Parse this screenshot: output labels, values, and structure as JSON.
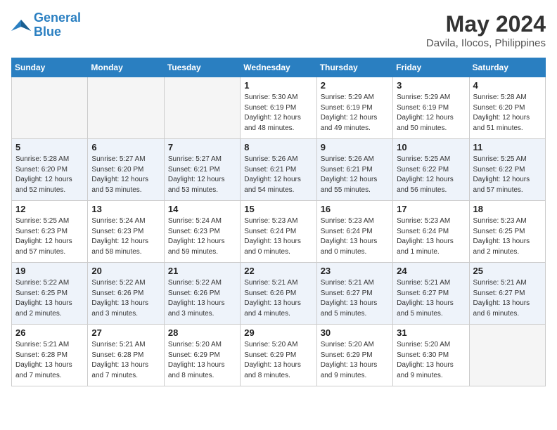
{
  "header": {
    "logo_line1": "General",
    "logo_line2": "Blue",
    "month_year": "May 2024",
    "location": "Davila, Ilocos, Philippines"
  },
  "days_of_week": [
    "Sunday",
    "Monday",
    "Tuesday",
    "Wednesday",
    "Thursday",
    "Friday",
    "Saturday"
  ],
  "weeks": [
    [
      {
        "day": "",
        "info": ""
      },
      {
        "day": "",
        "info": ""
      },
      {
        "day": "",
        "info": ""
      },
      {
        "day": "1",
        "info": "Sunrise: 5:30 AM\nSunset: 6:19 PM\nDaylight: 12 hours\nand 48 minutes."
      },
      {
        "day": "2",
        "info": "Sunrise: 5:29 AM\nSunset: 6:19 PM\nDaylight: 12 hours\nand 49 minutes."
      },
      {
        "day": "3",
        "info": "Sunrise: 5:29 AM\nSunset: 6:19 PM\nDaylight: 12 hours\nand 50 minutes."
      },
      {
        "day": "4",
        "info": "Sunrise: 5:28 AM\nSunset: 6:20 PM\nDaylight: 12 hours\nand 51 minutes."
      }
    ],
    [
      {
        "day": "5",
        "info": "Sunrise: 5:28 AM\nSunset: 6:20 PM\nDaylight: 12 hours\nand 52 minutes."
      },
      {
        "day": "6",
        "info": "Sunrise: 5:27 AM\nSunset: 6:20 PM\nDaylight: 12 hours\nand 53 minutes."
      },
      {
        "day": "7",
        "info": "Sunrise: 5:27 AM\nSunset: 6:21 PM\nDaylight: 12 hours\nand 53 minutes."
      },
      {
        "day": "8",
        "info": "Sunrise: 5:26 AM\nSunset: 6:21 PM\nDaylight: 12 hours\nand 54 minutes."
      },
      {
        "day": "9",
        "info": "Sunrise: 5:26 AM\nSunset: 6:21 PM\nDaylight: 12 hours\nand 55 minutes."
      },
      {
        "day": "10",
        "info": "Sunrise: 5:25 AM\nSunset: 6:22 PM\nDaylight: 12 hours\nand 56 minutes."
      },
      {
        "day": "11",
        "info": "Sunrise: 5:25 AM\nSunset: 6:22 PM\nDaylight: 12 hours\nand 57 minutes."
      }
    ],
    [
      {
        "day": "12",
        "info": "Sunrise: 5:25 AM\nSunset: 6:23 PM\nDaylight: 12 hours\nand 57 minutes."
      },
      {
        "day": "13",
        "info": "Sunrise: 5:24 AM\nSunset: 6:23 PM\nDaylight: 12 hours\nand 58 minutes."
      },
      {
        "day": "14",
        "info": "Sunrise: 5:24 AM\nSunset: 6:23 PM\nDaylight: 12 hours\nand 59 minutes."
      },
      {
        "day": "15",
        "info": "Sunrise: 5:23 AM\nSunset: 6:24 PM\nDaylight: 13 hours\nand 0 minutes."
      },
      {
        "day": "16",
        "info": "Sunrise: 5:23 AM\nSunset: 6:24 PM\nDaylight: 13 hours\nand 0 minutes."
      },
      {
        "day": "17",
        "info": "Sunrise: 5:23 AM\nSunset: 6:24 PM\nDaylight: 13 hours\nand 1 minute."
      },
      {
        "day": "18",
        "info": "Sunrise: 5:23 AM\nSunset: 6:25 PM\nDaylight: 13 hours\nand 2 minutes."
      }
    ],
    [
      {
        "day": "19",
        "info": "Sunrise: 5:22 AM\nSunset: 6:25 PM\nDaylight: 13 hours\nand 2 minutes."
      },
      {
        "day": "20",
        "info": "Sunrise: 5:22 AM\nSunset: 6:26 PM\nDaylight: 13 hours\nand 3 minutes."
      },
      {
        "day": "21",
        "info": "Sunrise: 5:22 AM\nSunset: 6:26 PM\nDaylight: 13 hours\nand 3 minutes."
      },
      {
        "day": "22",
        "info": "Sunrise: 5:21 AM\nSunset: 6:26 PM\nDaylight: 13 hours\nand 4 minutes."
      },
      {
        "day": "23",
        "info": "Sunrise: 5:21 AM\nSunset: 6:27 PM\nDaylight: 13 hours\nand 5 minutes."
      },
      {
        "day": "24",
        "info": "Sunrise: 5:21 AM\nSunset: 6:27 PM\nDaylight: 13 hours\nand 5 minutes."
      },
      {
        "day": "25",
        "info": "Sunrise: 5:21 AM\nSunset: 6:27 PM\nDaylight: 13 hours\nand 6 minutes."
      }
    ],
    [
      {
        "day": "26",
        "info": "Sunrise: 5:21 AM\nSunset: 6:28 PM\nDaylight: 13 hours\nand 7 minutes."
      },
      {
        "day": "27",
        "info": "Sunrise: 5:21 AM\nSunset: 6:28 PM\nDaylight: 13 hours\nand 7 minutes."
      },
      {
        "day": "28",
        "info": "Sunrise: 5:20 AM\nSunset: 6:29 PM\nDaylight: 13 hours\nand 8 minutes."
      },
      {
        "day": "29",
        "info": "Sunrise: 5:20 AM\nSunset: 6:29 PM\nDaylight: 13 hours\nand 8 minutes."
      },
      {
        "day": "30",
        "info": "Sunrise: 5:20 AM\nSunset: 6:29 PM\nDaylight: 13 hours\nand 9 minutes."
      },
      {
        "day": "31",
        "info": "Sunrise: 5:20 AM\nSunset: 6:30 PM\nDaylight: 13 hours\nand 9 minutes."
      },
      {
        "day": "",
        "info": ""
      }
    ]
  ]
}
